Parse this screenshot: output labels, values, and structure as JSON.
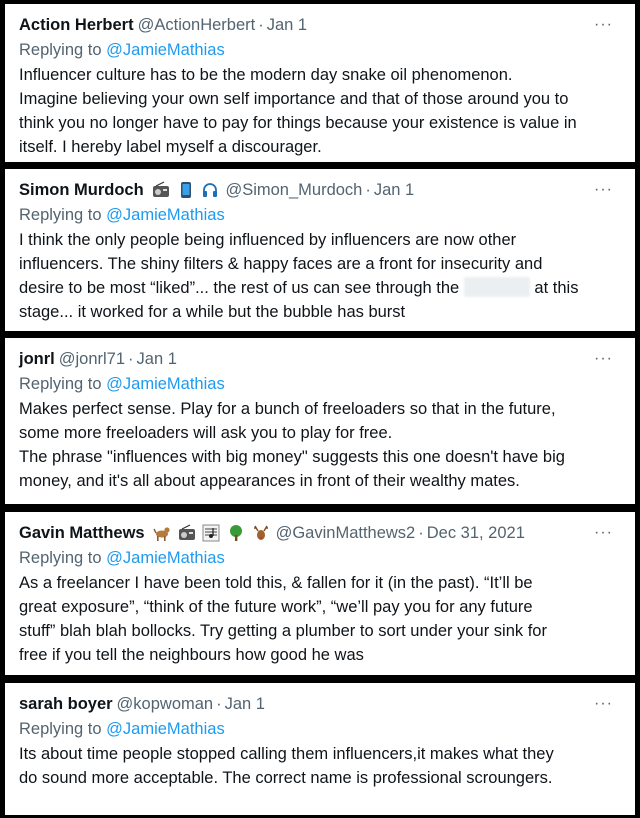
{
  "tweets": [
    {
      "name": "Action Herbert",
      "handle": "@ActionHerbert",
      "sep": "·",
      "date": "Jan 1",
      "more": "···",
      "replying_prefix": "Replying to",
      "replying_to": "@JamieMathias",
      "lines": [
        "Influencer culture has to be the modern day snake oil phenomenon.",
        "Imagine believing your own self importance and that of those around you to",
        "think you no longer have to pay for things because your existence is value in",
        "itself. I hereby label myself a discourager."
      ]
    },
    {
      "name": "Simon Murdoch",
      "emojis": [
        "radio-emoji",
        "mobile-phone-emoji",
        "headphones-emoji"
      ],
      "handle": "@Simon_Murdoch",
      "sep": "·",
      "date": "Jan 1",
      "more": "···",
      "replying_prefix": "Replying to",
      "replying_to": "@JamieMathias",
      "lines": [
        "I think the only people being influenced by influencers are now other",
        "influencers. The shiny filters & happy faces are a front for insecurity and",
        "desire to be most “liked”... the rest of us can see through the",
        "at this",
        "stage... it worked for a while but the bubble has burst"
      ]
    },
    {
      "name": "jonrl",
      "handle": "@jonrl71",
      "sep": "·",
      "date": "Jan 1",
      "more": "···",
      "replying_prefix": "Replying to",
      "replying_to": "@JamieMathias",
      "lines": [
        "Makes perfect sense. Play for a bunch of freeloaders so that in the future,",
        "some more freeloaders will ask you to play for free.",
        "The phrase \"influences with big money\" suggests this one doesn't have big",
        "money, and it's all about appearances in front of their wealthy mates."
      ]
    },
    {
      "name": "Gavin Matthews",
      "emojis": [
        "dog-emoji",
        "radio-emoji",
        "musical-score-emoji",
        "tree-emoji",
        "deer-emoji"
      ],
      "handle": "@GavinMatthews2",
      "sep": "·",
      "date": "Dec 31, 2021",
      "more": "···",
      "replying_prefix": "Replying to",
      "replying_to": "@JamieMathias",
      "lines": [
        "As a freelancer I have been told this, &  fallen for it (in the past). “It’ll be",
        "great exposure”, “think of the future work”, “we’ll pay you for any future",
        "stuff” blah blah bollocks. Try getting a plumber to sort under your sink for",
        "free if you tell the neighbours how good he was"
      ]
    },
    {
      "name": "sarah boyer",
      "handle": "@kopwoman",
      "sep": "·",
      "date": "Jan 1",
      "more": "···",
      "replying_prefix": "Replying to",
      "replying_to": "@JamieMathias",
      "lines": [
        "Its about time people stopped calling them influencers,it makes what they",
        "do sound more acceptable. The correct name is professional scroungers."
      ]
    }
  ],
  "colors": {
    "text": "#0f1419",
    "muted": "#536471",
    "link": "#1d9bf0",
    "background": "#000000",
    "card": "#ffffff"
  }
}
